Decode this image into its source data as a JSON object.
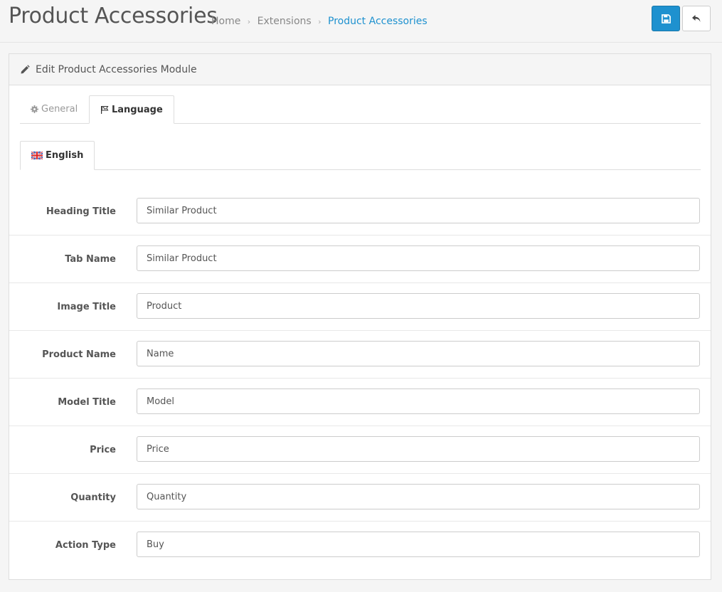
{
  "page": {
    "title": "Product Accessories",
    "breadcrumb": [
      "Home",
      "Extensions",
      "Product Accessories"
    ]
  },
  "actions": {
    "save_icon": "save-icon",
    "back_icon": "reply-icon",
    "save_color": "#1e91cf"
  },
  "panel": {
    "heading": "Edit Product Accessories Module",
    "heading_icon": "pencil-icon"
  },
  "tabs": [
    {
      "label": "General",
      "icon": "cog-icon",
      "active": false
    },
    {
      "label": "Language",
      "icon": "flag-icon",
      "active": true
    }
  ],
  "language_tabs": [
    {
      "label": "English",
      "icon": "uk-flag-icon",
      "active": true
    }
  ],
  "fields": [
    {
      "label": "Heading Title",
      "value": "Similar Product"
    },
    {
      "label": "Tab Name",
      "value": "Similar Product"
    },
    {
      "label": "Image Title",
      "value": "Product"
    },
    {
      "label": "Product Name",
      "value": "Name"
    },
    {
      "label": "Model Title",
      "value": "Model"
    },
    {
      "label": "Price",
      "value": "Price"
    },
    {
      "label": "Quantity",
      "value": "Quantity"
    },
    {
      "label": "Action Type",
      "value": "Buy"
    }
  ]
}
